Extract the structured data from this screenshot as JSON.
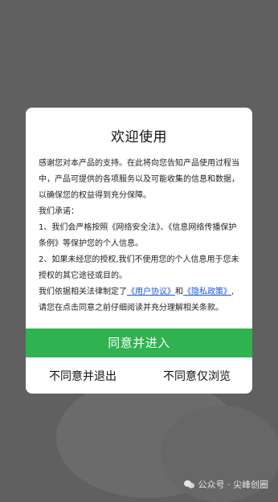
{
  "dialog": {
    "title": "欢迎使用",
    "intro": "感谢您对本产品的支持。在此将向您告知产品使用过程当中，产品可提供的各项服务以及可能收集的信息和数据，以确保您的权益得到充分保障。",
    "promise_heading": "我们承诺：",
    "promise_1": "1、我们会严格按照《网络安全法》、《信息网络传播保护条例》等保护您的个人信息。",
    "promise_2": "2、如果未经您的授权,我们不使用您的个人信息用于您未授权的其它途径或目的。",
    "policy_prefix": "我们依据相关法律制定了",
    "user_agreement_link": "《用户协议》",
    "policy_and": "和",
    "privacy_policy_link": "《隐私政策》",
    "policy_suffix": ",请您在点击同意之前仔细阅读并充分理解相关条款。",
    "agree_button": "同意并进入",
    "decline_button": "不同意并退出",
    "browse_only_button": "不同意仅浏览"
  },
  "watermark": {
    "text": "公众号 · 尖峰创圈",
    "icon": "wechat-icon"
  },
  "colors": {
    "overlay": "#606060",
    "accent_green": "#2fb24f",
    "link_blue": "#1a55d8"
  }
}
